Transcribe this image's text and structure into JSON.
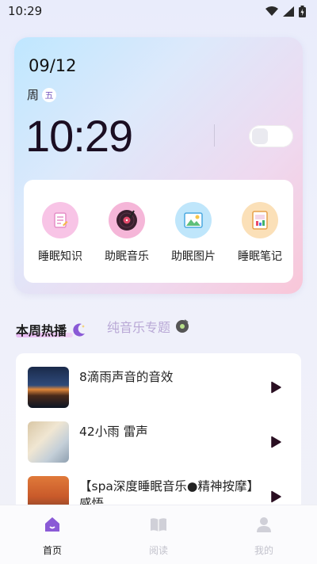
{
  "status_bar": {
    "time": "10:29"
  },
  "hero": {
    "date": "09/12",
    "weekday_prefix": "周",
    "weekday_badge": "五",
    "clock": "10:29"
  },
  "features": [
    {
      "label": "睡眠知识",
      "icon": "notepad-icon",
      "color": "#f8c4e6"
    },
    {
      "label": "助眠音乐",
      "icon": "vinyl-record-icon",
      "color": "#f5b6d8"
    },
    {
      "label": "助眠图片",
      "icon": "picture-icon",
      "color": "#bfe6fb"
    },
    {
      "label": "睡眠笔记",
      "icon": "notebook-icon",
      "color": "#fbe0b8"
    }
  ],
  "tabs": {
    "active": "本周热播",
    "inactive": "纯音乐专题"
  },
  "songs": [
    {
      "title": "8滴雨声音的音效"
    },
    {
      "title": "42小雨 雷声"
    },
    {
      "title": "【spa深度睡眠音乐●精神按摩】感悟"
    }
  ],
  "nav": {
    "items": [
      {
        "label": "首页",
        "active": true
      },
      {
        "label": "阅读",
        "active": false
      },
      {
        "label": "我的",
        "active": false
      }
    ],
    "active_color": "#7b4fd6",
    "inactive_color": "#c9c9d2"
  }
}
